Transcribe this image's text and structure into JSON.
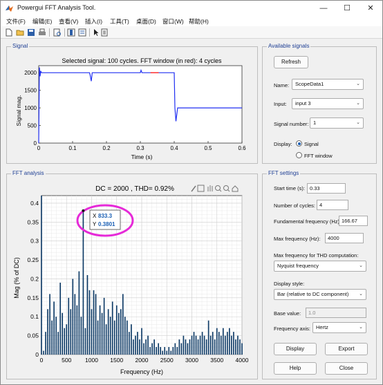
{
  "window": {
    "title": "Powergui FFT Analysis Tool.",
    "controls": {
      "minimize": "—",
      "maximize": "☐",
      "close": "✕"
    }
  },
  "menu": [
    "文件(F)",
    "编辑(E)",
    "查看(V)",
    "插入(I)",
    "工具(T)",
    "桌面(D)",
    "窗口(W)",
    "帮助(H)"
  ],
  "signal_panel": {
    "title": "Signal",
    "chart_data": {
      "type": "line",
      "title": "Selected signal: 100 cycles. FFT window (in red): 4 cycles",
      "xlabel": "Time (s)",
      "ylabel": "Signal mag.",
      "xlim": [
        0,
        0.6
      ],
      "ylim": [
        0,
        2200
      ],
      "xticks": [
        "0",
        "0.1",
        "0.2",
        "0.3",
        "0.4",
        "0.5",
        "0.6"
      ],
      "yticks": [
        "0",
        "500",
        "1000",
        "1500",
        "2000"
      ],
      "series": [
        {
          "color": "#1f2ef2",
          "x": [
            0,
            0.002,
            0.004,
            0.006,
            0.008,
            0.01,
            0.15,
            0.152,
            0.155,
            0.158,
            0.3,
            0.302,
            0.305,
            0.4,
            0.402,
            0.405,
            0.41,
            0.42,
            0.6
          ],
          "y": [
            0,
            2150,
            1900,
            2050,
            2000,
            2000,
            2000,
            1920,
            1760,
            2000,
            2000,
            2070,
            2000,
            2000,
            1000,
            620,
            1000,
            1000,
            1000
          ]
        },
        {
          "color": "#ff3a3a",
          "x": [
            0.33,
            0.354
          ],
          "y": [
            2000,
            2000
          ]
        }
      ]
    }
  },
  "fft_panel": {
    "title": "FFT analysis",
    "chart_data": {
      "type": "bar",
      "title": "DC = 2000 , THD= 0.92%",
      "xlabel": "Frequency (Hz)",
      "ylabel": "Mag (% of DC)",
      "xlim": [
        0,
        4000
      ],
      "ylim": [
        0,
        0.42
      ],
      "xticks": [
        "0",
        "500",
        "1000",
        "1500",
        "2000",
        "2500",
        "3000",
        "3500",
        "4000"
      ],
      "yticks": [
        "0",
        "0.05",
        "0.1",
        "0.15",
        "0.2",
        "0.25",
        "0.3",
        "0.35",
        "0.4"
      ],
      "bar_color": "#0d3a66",
      "x": [
        0,
        41.7,
        83.3,
        125,
        166.7,
        208.3,
        250,
        291.7,
        333.3,
        375,
        416.7,
        458.3,
        500,
        541.7,
        583.3,
        625,
        666.7,
        708.3,
        750,
        791.7,
        833.3,
        875,
        916.7,
        958.3,
        1000,
        1041.7,
        1083.3,
        1125,
        1166.7,
        1208.3,
        1250,
        1291.7,
        1333.3,
        1375,
        1416.7,
        1458.3,
        1500,
        1541.7,
        1583.3,
        1625,
        1666.7,
        1708.3,
        1750,
        1791.7,
        1833.3,
        1875,
        1916.7,
        1958.3,
        2000,
        2041.7,
        2083.3,
        2125,
        2166.7,
        2208.3,
        2250,
        2291.7,
        2333.3,
        2375,
        2416.7,
        2458.3,
        2500,
        2541.7,
        2583.3,
        2625,
        2666.7,
        2708.3,
        2750,
        2791.7,
        2833.3,
        2875,
        2916.7,
        2958.3,
        3000,
        3041.7,
        3083.3,
        3125,
        3166.7,
        3208.3,
        3250,
        3291.7,
        3333.3,
        3375,
        3416.7,
        3458.3,
        3500,
        3541.7,
        3583.3,
        3625,
        3666.7,
        3708.3,
        3750,
        3791.7,
        3833.3,
        3875,
        3916.7,
        3958.3,
        4000
      ],
      "values": [
        0.42,
        0.01,
        0.06,
        0.12,
        0.16,
        0.09,
        0.14,
        0.1,
        0.06,
        0.19,
        0.11,
        0.07,
        0.08,
        0.15,
        0.12,
        0.2,
        0.16,
        0.13,
        0.22,
        0.1,
        0.38,
        0.07,
        0.21,
        0.17,
        0.12,
        0.17,
        0.16,
        0.09,
        0.13,
        0.11,
        0.15,
        0.08,
        0.12,
        0.1,
        0.14,
        0.09,
        0.13,
        0.11,
        0.12,
        0.16,
        0.1,
        0.09,
        0.06,
        0.08,
        0.04,
        0.05,
        0.06,
        0.04,
        0.07,
        0.03,
        0.04,
        0.05,
        0.02,
        0.03,
        0.04,
        0.02,
        0.03,
        0.02,
        0.01,
        0.02,
        0.01,
        0.02,
        0.01,
        0.02,
        0.03,
        0.02,
        0.04,
        0.03,
        0.05,
        0.04,
        0.03,
        0.04,
        0.05,
        0.06,
        0.05,
        0.04,
        0.05,
        0.06,
        0.05,
        0.04,
        0.09,
        0.05,
        0.06,
        0.04,
        0.07,
        0.06,
        0.05,
        0.07,
        0.05,
        0.06,
        0.07,
        0.05,
        0.06,
        0.04,
        0.05,
        0.04,
        0.03
      ],
      "datatip": {
        "x_label": "X",
        "x_value": "833.3",
        "y_label": "Y",
        "y_value": "0.3801"
      },
      "annotation_color": "#e62ad8"
    }
  },
  "available_signals": {
    "title": "Available signals",
    "refresh_label": "Refresh",
    "name_label": "Name:",
    "name_value": "ScopeData1",
    "input_label": "Input:",
    "input_value": "input 3",
    "signal_number_label": "Signal number:",
    "signal_number_value": "1",
    "display_label": "Display:",
    "display_option_signal": "Signal",
    "display_option_fft": "FFT window",
    "display_selected": "Signal"
  },
  "fft_settings": {
    "title": "FFT settings",
    "start_time_label": "Start time (s):",
    "start_time_value": "0.33",
    "cycles_label": "Number of cycles:",
    "cycles_value": "4",
    "fund_freq_label": "Fundamental frequency (Hz):",
    "fund_freq_value": "166.67",
    "max_freq_label": "Max frequency (Hz):",
    "max_freq_value": "4000",
    "thd_label": "Max frequency for THD computation:",
    "thd_value": "Nyquist frequency",
    "display_style_label": "Display style:",
    "display_style_value": "Bar (relative to DC component)",
    "base_value_label": "Base value:",
    "base_value_value": "1.0",
    "freq_axis_label": "Frequency axis:",
    "freq_axis_value": "Hertz",
    "display_button": "Display",
    "export_button": "Export",
    "help_button": "Help",
    "close_button": "Close"
  },
  "colors": {
    "panel_title": "#1f3f94",
    "accent": "#1a5fb4"
  }
}
